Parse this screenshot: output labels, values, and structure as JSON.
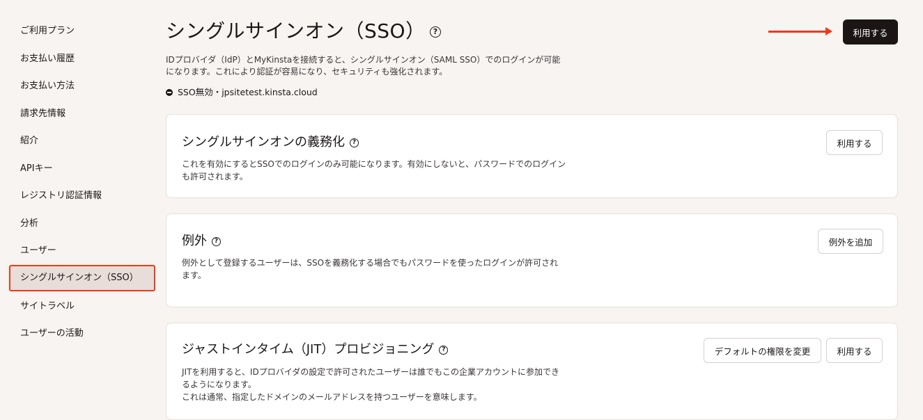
{
  "sidebar": {
    "items": [
      {
        "label": "ご利用プラン"
      },
      {
        "label": "お支払い履歴"
      },
      {
        "label": "お支払い方法"
      },
      {
        "label": "請求先情報"
      },
      {
        "label": "紹介"
      },
      {
        "label": "APIキー"
      },
      {
        "label": "レジストリ認証情報"
      },
      {
        "label": "分析"
      },
      {
        "label": "ユーザー"
      },
      {
        "label": "シングルサインオン（SSO）"
      },
      {
        "label": "サイトラベル"
      },
      {
        "label": "ユーザーの活動"
      }
    ],
    "active_index": 9
  },
  "header": {
    "title": "シングルサインオン（SSO）",
    "help_glyph": "?",
    "description_line1": "IDプロバイダ（IdP）とMyKinstaを接続すると、シングルサインオン（SAML SSO）でのログインが可能",
    "description_line2": "になります。これにより認証が容易になり、セキュリティも強化されます。",
    "status": "SSO無効・jpsitetest.kinsta.cloud",
    "primary_button": "利用する"
  },
  "cards": {
    "enforce": {
      "title": "シングルサインオンの義務化",
      "desc_line1": "これを有効にするとSSOでのログインのみ可能になります。有効にしないと、パスワードでのログイン",
      "desc_line2": "も許可されます。",
      "button": "利用する"
    },
    "exceptions": {
      "title": "例外",
      "desc_line1": "例外として登録するユーザーは、SSOを義務化する場合でもパスワードを使ったログインが許可され",
      "desc_line2": "ます。",
      "button": "例外を追加"
    },
    "jit": {
      "title": "ジャストインタイム（JIT）プロビジョニング",
      "desc_line1": "JITを利用すると、IDプロバイダの設定で許可されたユーザーは誰でもこの企業アカウントに参加でき",
      "desc_line2": "るようになります。",
      "desc_line3": "これは通常、指定したドメインのメールアドレスを持つユーザーを意味します。",
      "button_secondary": "デフォルトの権限を変更",
      "button": "利用する"
    }
  },
  "colors": {
    "background": "#f8f4f2",
    "accent": "#ef3a16",
    "primary_button": "#1b1515",
    "active_item_bg": "#e8ddd8"
  }
}
